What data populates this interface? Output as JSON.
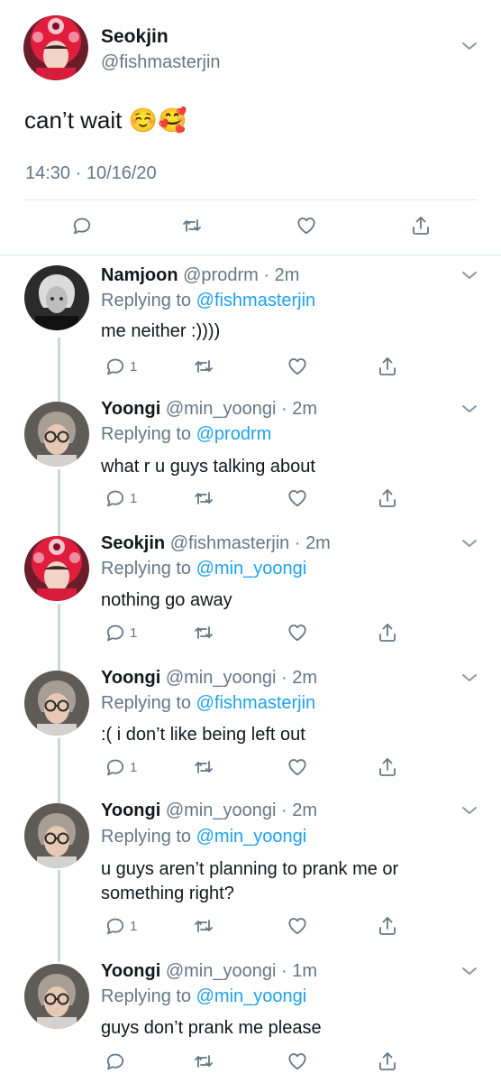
{
  "main_tweet": {
    "name": "Seokjin",
    "handle": "@fishmasterjin",
    "text": "can’t wait ☺️🥰",
    "timestamp": "14:30 · 10/16/20",
    "avatar": "red-hat-avatar"
  },
  "actions": {
    "reply_icon": "reply-icon",
    "retweet_icon": "retweet-icon",
    "like_icon": "heart-icon",
    "share_icon": "share-icon"
  },
  "replies": [
    {
      "name": "Namjoon",
      "handle": "@prodrm",
      "time": "2m",
      "replying_prefix": "Replying to",
      "replying_to": "@fishmasterjin",
      "text_lines": [
        "me neither :))))"
      ],
      "reply_count": "1",
      "avatar": "bw-portrait-avatar"
    },
    {
      "name": "Yoongi",
      "handle": "@min_yoongi",
      "time": "2m",
      "replying_prefix": "Replying to",
      "replying_to": "@prodrm",
      "text_lines": [
        "what r u guys talking about"
      ],
      "reply_count": "1",
      "avatar": "glasses-portrait-avatar"
    },
    {
      "name": "Seokjin",
      "handle": "@fishmasterjin",
      "time": "2m",
      "replying_prefix": "Replying to",
      "replying_to": "@min_yoongi",
      "text_lines": [
        "nothing go away"
      ],
      "reply_count": "1",
      "avatar": "red-hat-avatar"
    },
    {
      "name": "Yoongi",
      "handle": "@min_yoongi",
      "time": "2m",
      "replying_prefix": "Replying to",
      "replying_to": "@fishmasterjin",
      "text_lines": [
        ":( i don’t like being left out"
      ],
      "reply_count": "1",
      "avatar": "glasses-portrait-avatar"
    },
    {
      "name": "Yoongi",
      "handle": "@min_yoongi",
      "time": "2m",
      "replying_prefix": "Replying to",
      "replying_to": "@min_yoongi",
      "text_lines": [
        "u guys aren’t planning to prank me or",
        "something right?"
      ],
      "reply_count": "1",
      "avatar": "glasses-portrait-avatar"
    },
    {
      "name": "Yoongi",
      "handle": "@min_yoongi",
      "time": "1m",
      "replying_prefix": "Replying to",
      "replying_to": "@min_yoongi",
      "text_lines": [
        "guys don’t prank me please"
      ],
      "reply_count": "",
      "avatar": "glasses-portrait-avatar"
    }
  ],
  "colors": {
    "link": "#1da1f2",
    "muted": "#657786",
    "text": "#14171a",
    "divider": "#e1e8ed",
    "thread_line": "#ccd6dd"
  }
}
